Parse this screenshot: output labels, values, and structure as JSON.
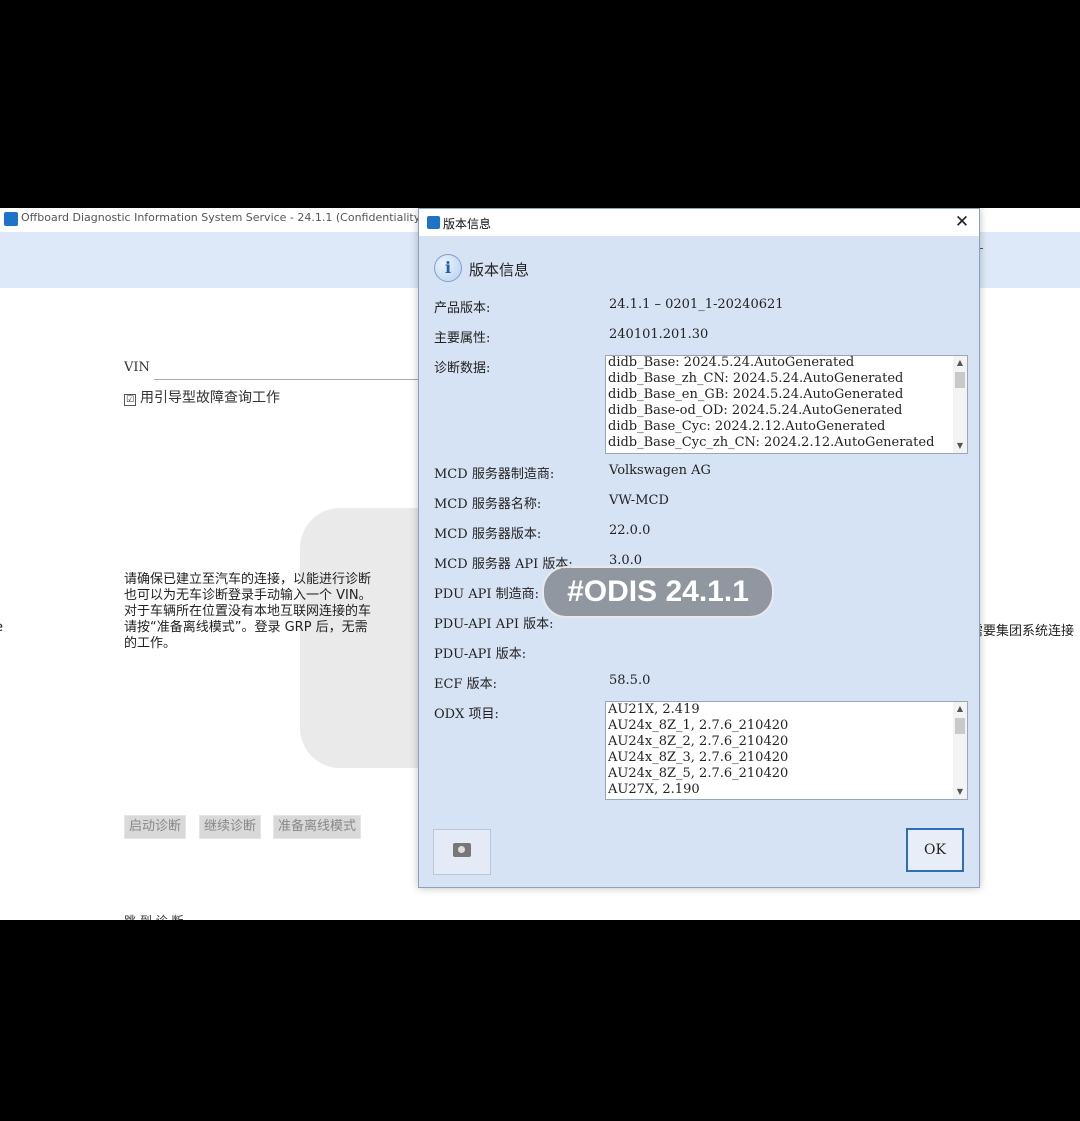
{
  "window": {
    "title": "Offboard Diagnostic Information System Service - 24.1.1 (Confidentiality leve"
  },
  "main": {
    "vin_label": "VIN",
    "vin_value": "",
    "guided_check_label": "用引导型故障查询工作",
    "guided_check_mark": "☑",
    "instructions": "请确保已建立至汽车的连接，以能进行诊断\n也可以为无车诊断登录手动输入一个 VIN。\n对于车辆所在位置没有本地互联网连接的车\n请按“准备离线模式”。登录 GRP 后，无需\n的工作。",
    "right_fragment": "需要集团系统连接",
    "left_fragment": "e",
    "buttons": {
      "start": "启动诊断",
      "continue": "继续诊断",
      "offline": "准备离线模式"
    },
    "bottom_fragment": "跳 到 诊 断"
  },
  "dialog": {
    "title": "版本信息",
    "close_glyph": "✕",
    "heading": "版本信息",
    "info_glyph": "i",
    "fields": {
      "product_version_label": "产品版本:",
      "product_version_value": "24.1.1  –  0201_1-20240621",
      "main_attr_label": "主要属性:",
      "main_attr_value": "240101.201.30",
      "diag_data_label": "诊断数据:",
      "mcd_vendor_label": "MCD 服务器制造商:",
      "mcd_vendor_value": "Volkswagen AG",
      "mcd_name_label": "MCD 服务器名称:",
      "mcd_name_value": "VW-MCD",
      "mcd_version_label": "MCD 服务器版本:",
      "mcd_version_value": "22.0.0",
      "mcd_api_label": "MCD 服务器 API 版本:",
      "mcd_api_value": "3.0.0",
      "pdu_vendor_label": "PDU API 制造商:",
      "pdu_api_label": "PDU-API API 版本:",
      "pdu_version_label": "PDU-API 版本:",
      "ecf_label": "ECF 版本:",
      "ecf_value": "58.5.0",
      "odx_label": "ODX 项目:"
    },
    "diag_data_items": [
      "didb_Base: 2024.5.24.AutoGenerated",
      "didb_Base_zh_CN: 2024.5.24.AutoGenerated",
      "didb_Base_en_GB: 2024.5.24.AutoGenerated",
      "didb_Base-od_OD: 2024.5.24.AutoGenerated",
      "didb_Base_Cyc: 2024.2.12.AutoGenerated",
      "didb_Base_Cyc_zh_CN: 2024.2.12.AutoGenerated"
    ],
    "odx_items": [
      "AU21X,  2.419",
      "AU24x_8Z_1,  2.7.6_210420",
      "AU24x_8Z_2,  2.7.6_210420",
      "AU24x_8Z_3,  2.7.6_210420",
      "AU24x_8Z_5,  2.7.6_210420",
      "AU27X,  2.190"
    ],
    "ok_label": "OK"
  },
  "overlay": {
    "watermark": "#ODIS 24.1.1"
  },
  "colors": {
    "dialog_bg": "#d6e3f5",
    "ribbon_bg": "#dde9f8",
    "accent": "#2d6fb7"
  },
  "icons": {
    "app": "odis-app-icon",
    "info": "info-icon",
    "camera": "camera-icon",
    "close": "close-icon"
  }
}
